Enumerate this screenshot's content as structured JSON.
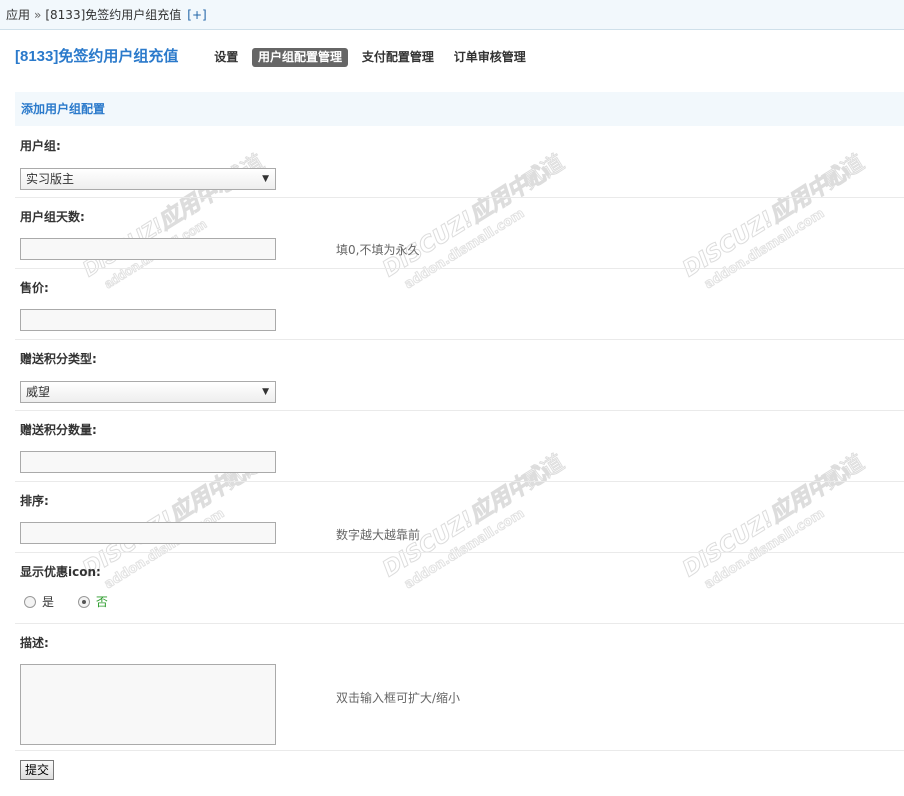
{
  "breadcrumb": {
    "root": "应用",
    "separator": "»",
    "current": "[8133]免签约用户组充值",
    "add": "[+]"
  },
  "plugin_title": "[8133]免签约用户组充值",
  "nav": [
    {
      "label": "设置",
      "active": false
    },
    {
      "label": "用户组配置管理",
      "active": true
    },
    {
      "label": "支付配置管理",
      "active": false
    },
    {
      "label": "订单审核管理",
      "active": false
    }
  ],
  "form": {
    "section_title": "添加用户组配置",
    "usergroup": {
      "label": "用户组:",
      "value": "实习版主"
    },
    "days": {
      "label": "用户组天数:",
      "value": "",
      "tip": "填0,不填为永久"
    },
    "price": {
      "label": "售价:",
      "value": ""
    },
    "credit_type": {
      "label": "赠送积分类型:",
      "value": "威望"
    },
    "credit_amount": {
      "label": "赠送积分数量:",
      "value": ""
    },
    "sort": {
      "label": "排序:",
      "value": "",
      "tip": "数字越大越靠前"
    },
    "show_icon": {
      "label": "显示优惠icon:",
      "options": [
        "是",
        "否"
      ],
      "selected": "否"
    },
    "description": {
      "label": "描述:",
      "value": "",
      "tip": "双击输入框可扩大/缩小"
    },
    "submit_label": "提交"
  },
  "watermark": {
    "brand": "DISCUZ!应用中心",
    "url": "addon.dismall.com",
    "tag": "贰道"
  }
}
